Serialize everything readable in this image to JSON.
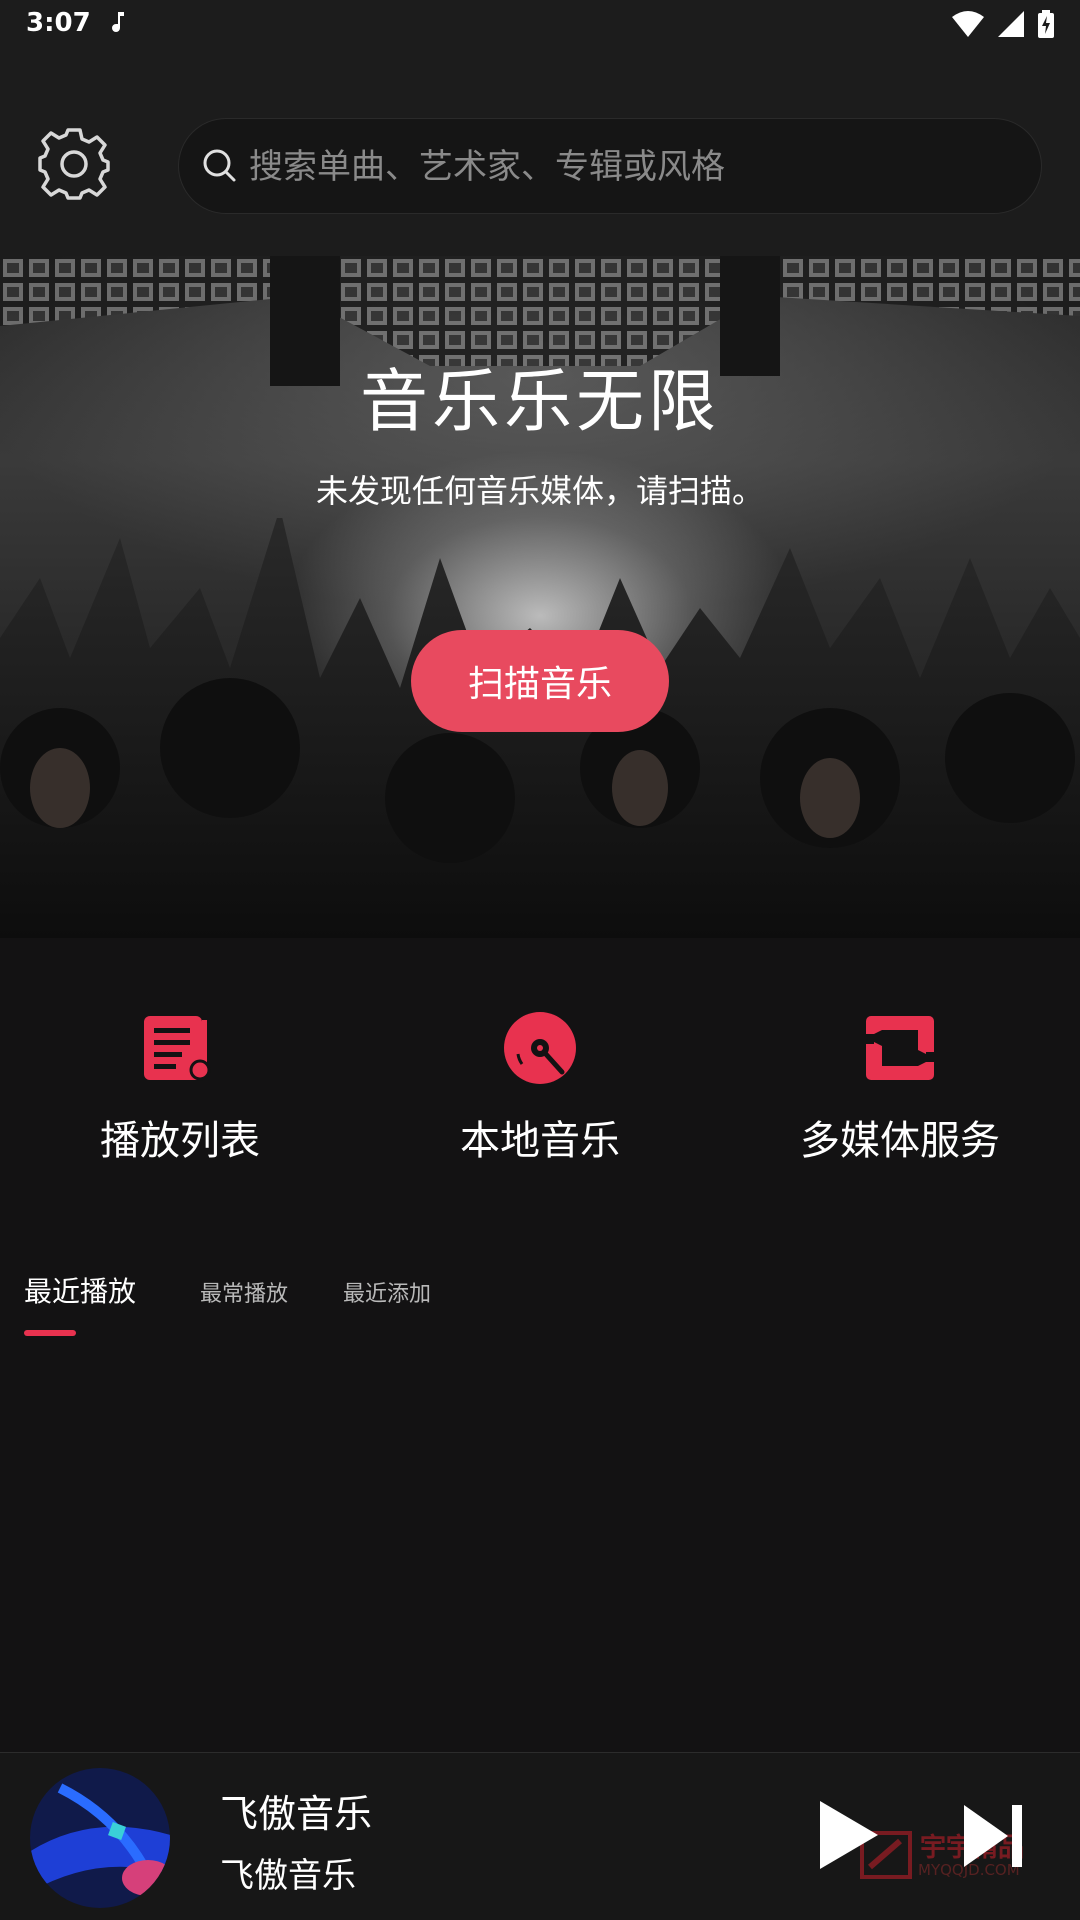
{
  "status_bar": {
    "time": "3:07"
  },
  "header": {
    "search_placeholder": "搜索单曲、艺术家、专辑或风格"
  },
  "hero": {
    "title": "音乐乐无限",
    "subtitle": "未发现任何音乐媒体，请扫描。",
    "scan_button_label": "扫描音乐"
  },
  "shortcuts": [
    {
      "label": "播放列表",
      "icon": "playlist-icon"
    },
    {
      "label": "本地音乐",
      "icon": "vinyl-record-icon"
    },
    {
      "label": "多媒体服务",
      "icon": "media-service-icon"
    }
  ],
  "tabs": [
    {
      "label": "最近播放",
      "active": true
    },
    {
      "label": "最常播放",
      "active": false
    },
    {
      "label": "最近添加",
      "active": false
    }
  ],
  "player": {
    "title": "飞傲音乐",
    "artist": "飞傲音乐"
  },
  "watermark": {
    "line1": "宇宇精品",
    "line2": "MYQQJD.COM"
  },
  "colors": {
    "accent": "#e8324f",
    "button": "#e84a5f",
    "background": "#131213",
    "surface": "#1c1c1c"
  }
}
